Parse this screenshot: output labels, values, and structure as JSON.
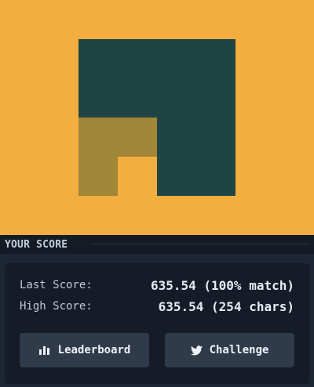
{
  "preview": {
    "colors": {
      "background": "#f4ad3f",
      "dark": "#1f4443",
      "olive": "#a08637"
    }
  },
  "score": {
    "header": "YOUR SCORE",
    "last_label": "Last Score:",
    "last_value": "635.54 (100% match)",
    "high_label": "High Score:",
    "high_value": "635.54 (254 chars)",
    "leaderboard_label": "Leaderboard",
    "leaderboard_icon": "bar-chart-icon",
    "challenge_label": "Challenge",
    "challenge_icon": "twitter-bird-icon"
  }
}
